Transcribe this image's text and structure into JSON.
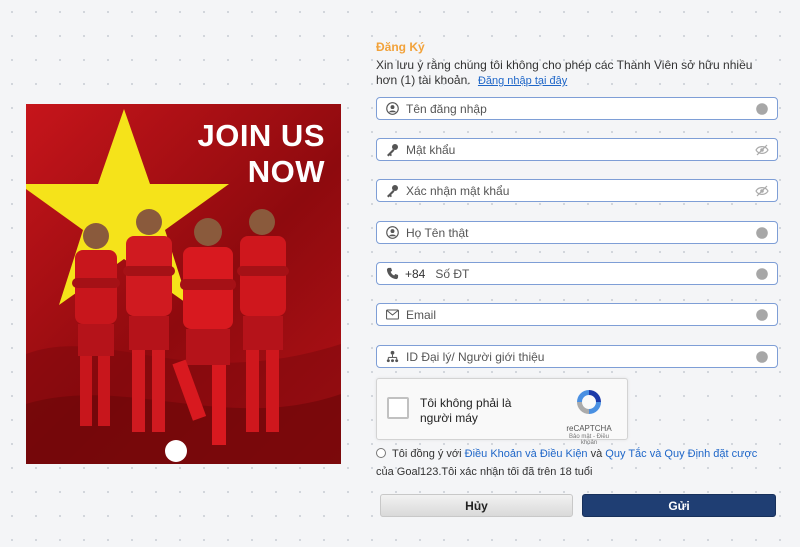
{
  "banner": {
    "line1": "JOIN US",
    "line2": "NOW"
  },
  "form": {
    "title": "Đăng Ký",
    "notice": "Xin lưu ý rằng chúng tôi không cho phép các Thành Viên sở hữu nhiều hơn (1) tài khoản.",
    "login_link": "Đăng nhập tại đây",
    "fields": {
      "username": {
        "placeholder": "Tên đăng nhập",
        "icon": "user-icon",
        "trail": "info-icon"
      },
      "password": {
        "placeholder": "Mật khẩu",
        "icon": "key-icon",
        "trail": "eye-slash-icon"
      },
      "confirm_password": {
        "placeholder": "Xác nhận mật khẩu",
        "icon": "key-icon",
        "trail": "eye-slash-icon"
      },
      "fullname": {
        "placeholder": "Họ Tên thật",
        "icon": "user-icon",
        "trail": "info-icon"
      },
      "phone": {
        "prefix": "+84",
        "placeholder": "Số ĐT",
        "icon": "phone-icon",
        "trail": "info-icon"
      },
      "email": {
        "placeholder": "Email",
        "icon": "mail-icon",
        "trail": "info-icon"
      },
      "agent": {
        "placeholder": "ID Đại lý/ Người giới thiệu",
        "icon": "org-icon",
        "trail": "info-icon"
      }
    },
    "captcha": {
      "label": "Tôi không phải là người máy",
      "brand": "reCAPTCHA",
      "links": "Bảo mật - Điều khoản"
    },
    "agreement": {
      "prefix": "Tôi đồng ý với ",
      "terms": "Điều Khoản và Điều Kiện",
      "and": " và ",
      "rules": "Quy Tắc và Quy Định đặt cược",
      "suffix": " của Goal123.Tôi xác nhận tôi đã trên 18 tuổi"
    },
    "cancel_label": "Hủy",
    "submit_label": "Gửi"
  },
  "colors": {
    "accent": "#f2a23a",
    "link": "#1e66c8",
    "field_border": "#7e9ed6",
    "submit": "#1f3e73",
    "banner_red": "#c6151b",
    "star_yellow": "#f5e31a"
  }
}
